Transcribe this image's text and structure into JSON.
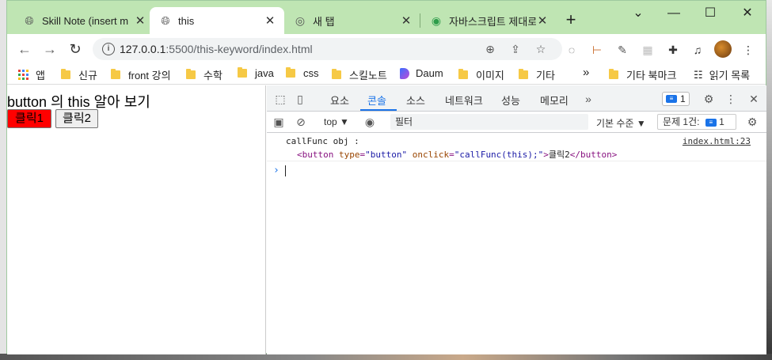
{
  "tabs": [
    {
      "title": "Skill Note (insert m",
      "icon": "globe-icon"
    },
    {
      "title": "this",
      "icon": "globe-icon",
      "active": true
    },
    {
      "title": "새 탭",
      "icon": "chrome-icon"
    },
    {
      "title": "자바스크립트 제대로",
      "icon": "site-icon"
    }
  ],
  "address": {
    "host": "127.0.0.1",
    "path": ":5500/this-keyword/index.html"
  },
  "bookmarks": {
    "apps": "앱",
    "items": [
      "신규",
      "front 강의",
      "수학",
      "java",
      "css",
      "스킬노트",
      "Daum",
      "이미지",
      "기타"
    ],
    "more": "»",
    "other": "기타 북마크",
    "reading": "읽기 목록"
  },
  "page": {
    "heading": "button 의 this 알아 보기",
    "button1": "클릭1",
    "button2": "클릭2"
  },
  "devtools": {
    "tabs": [
      "요소",
      "콘솔",
      "소스",
      "네트워크",
      "성능",
      "메모리"
    ],
    "active_tab": "콘솔",
    "issues_badge": "1",
    "context": "top ▼",
    "filter_placeholder": "필터",
    "levels": "기본 수준 ▼",
    "issues_label": "문제 1건:",
    "issues_count": "1",
    "log": {
      "label": "callFunc obj :",
      "source": "index.html:23",
      "tag_open": "<button",
      "attr1": "type",
      "val1": "\"button\"",
      "attr2": "onclick",
      "val2": "\"callFunc(this);\"",
      "content": "클릭2",
      "tag_close": "</button>"
    },
    "prompt": "›"
  },
  "colors": {
    "tabstrip": "#bfe5b3",
    "button1_bg": "#ff0000",
    "accent": "#1a73e8"
  }
}
